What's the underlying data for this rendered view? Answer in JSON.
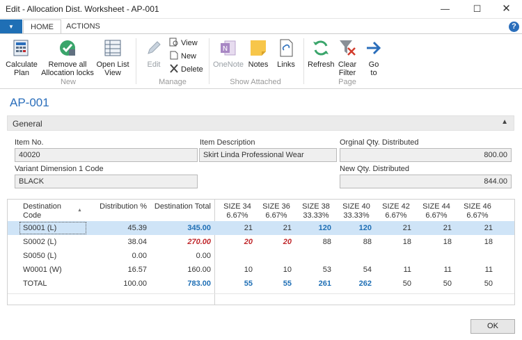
{
  "window": {
    "title": "Edit - Allocation Dist. Worksheet - AP-001"
  },
  "tabs": [
    {
      "label": "HOME"
    },
    {
      "label": "ACTIONS"
    }
  ],
  "help_label": "?",
  "ribbon": {
    "calculate_plan": "Calculate\nPlan",
    "remove_all_locks": "Remove all\nAllocation locks",
    "open_list_view": "Open List\nView",
    "group_new": "New",
    "edit": "Edit",
    "view": "View",
    "new": "New",
    "delete": "Delete",
    "group_manage": "Manage",
    "onenote": "OneNote",
    "notes": "Notes",
    "links": "Links",
    "group_show_attached": "Show Attached",
    "refresh": "Refresh",
    "clear_filter": "Clear\nFilter",
    "go_to": "Go\nto",
    "group_page": "Page"
  },
  "page_title": "AP-001",
  "general": {
    "header": "General",
    "item_no_label": "Item No.",
    "item_no": "40020",
    "item_desc_label": "Item Description",
    "item_desc": "Skirt Linda Professional Wear",
    "orig_qty_label": "Orginal Qty. Distributed",
    "orig_qty": "800.00",
    "variant_label": "Variant Dimension 1 Code",
    "variant": "BLACK",
    "new_qty_label": "New Qty. Distributed",
    "new_qty": "844.00"
  },
  "grid": {
    "headers": {
      "dest_code": "Destination\nCode",
      "dist_pct": "Distribution %",
      "dest_total": "Destination Total"
    },
    "sizes": [
      {
        "name": "SIZE 34",
        "pct": "6.67%"
      },
      {
        "name": "SIZE 36",
        "pct": "6.67%"
      },
      {
        "name": "SIZE 38",
        "pct": "33.33%"
      },
      {
        "name": "SIZE 40",
        "pct": "33.33%"
      },
      {
        "name": "SIZE 42",
        "pct": "6.67%"
      },
      {
        "name": "SIZE 44",
        "pct": "6.67%"
      },
      {
        "name": "SIZE 46",
        "pct": "6.67%"
      }
    ],
    "rows": [
      {
        "code": "S0001 (L)",
        "pct": "45.39",
        "total": "345.00",
        "s": [
          "21",
          "21",
          "120",
          "120",
          "21",
          "21",
          "21"
        ]
      },
      {
        "code": "S0002 (L)",
        "pct": "38.04",
        "total": "270.00",
        "s": [
          "20",
          "20",
          "88",
          "88",
          "18",
          "18",
          "18"
        ]
      },
      {
        "code": "S0050 (L)",
        "pct": "0.00",
        "total": "0.00",
        "s": [
          "",
          "",
          "",
          "",
          "",
          "",
          ""
        ]
      },
      {
        "code": "W0001 (W)",
        "pct": "16.57",
        "total": "160.00",
        "s": [
          "10",
          "10",
          "53",
          "54",
          "11",
          "11",
          "11"
        ]
      },
      {
        "code": "TOTAL",
        "pct": "100.00",
        "total": "783.00",
        "s": [
          "55",
          "55",
          "261",
          "262",
          "50",
          "50",
          "50"
        ]
      }
    ]
  },
  "ok_label": "OK"
}
